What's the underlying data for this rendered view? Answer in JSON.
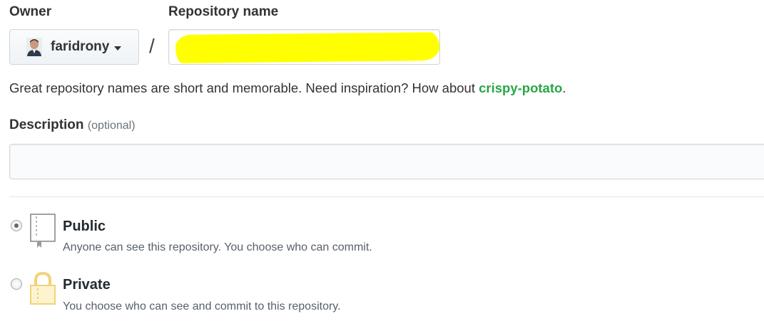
{
  "owner": {
    "label": "Owner",
    "selected": "faridrony"
  },
  "repository": {
    "label": "Repository name",
    "separator": "/",
    "value": ""
  },
  "hint": {
    "text": "Great repository names are short and memorable. Need inspiration? How about ",
    "suggestion": "crispy-potato",
    "end": "."
  },
  "description": {
    "label": "Description",
    "optional": "(optional)",
    "value": ""
  },
  "visibility": {
    "public": {
      "title": "Public",
      "desc": "Anyone can see this repository. You choose who can commit.",
      "selected": true
    },
    "private": {
      "title": "Private",
      "desc": "You choose who can see and commit to this repository.",
      "selected": false
    }
  },
  "colors": {
    "suggestion": "#28a745",
    "redaction": "#ffff00",
    "lock_icon": "#f2d27a"
  },
  "icons": {
    "avatar": "user-avatar",
    "public": "repo-book-icon",
    "private": "lock-icon"
  }
}
